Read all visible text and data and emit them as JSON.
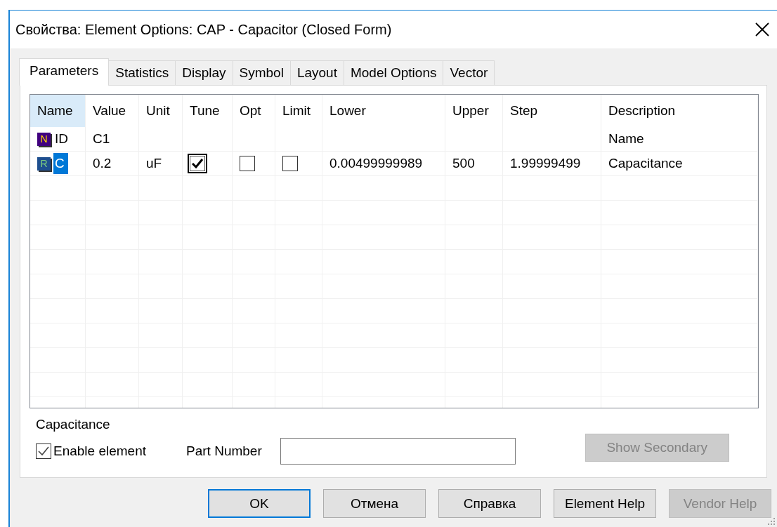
{
  "window": {
    "title": "Свойства: Element Options: CAP - Capacitor (Closed Form)"
  },
  "tabs": [
    {
      "label": "Parameters",
      "selected": true
    },
    {
      "label": "Statistics",
      "selected": false
    },
    {
      "label": "Display",
      "selected": false
    },
    {
      "label": "Symbol",
      "selected": false
    },
    {
      "label": "Layout",
      "selected": false
    },
    {
      "label": "Model Options",
      "selected": false
    },
    {
      "label": "Vector",
      "selected": false
    }
  ],
  "table": {
    "columns": [
      {
        "label": "Name",
        "highlighted": true
      },
      {
        "label": "Value",
        "highlighted": false
      },
      {
        "label": "Unit",
        "highlighted": false
      },
      {
        "label": "Tune",
        "highlighted": false
      },
      {
        "label": "Opt",
        "highlighted": false
      },
      {
        "label": "Limit",
        "highlighted": false
      },
      {
        "label": "Lower",
        "highlighted": false
      },
      {
        "label": "Upper",
        "highlighted": false
      },
      {
        "label": "Step",
        "highlighted": false
      },
      {
        "label": "Description",
        "highlighted": false
      }
    ],
    "rows": [
      {
        "badge": {
          "letter": "N",
          "kind": "name",
          "color": "#40007f"
        },
        "name": "ID",
        "selected": false,
        "value": "C1",
        "description": "Name"
      },
      {
        "badge": {
          "letter": "R",
          "kind": "real",
          "color": "#1e4f8f"
        },
        "name": "C",
        "selected": true,
        "value": "0.2",
        "unit": "uF",
        "tune": {
          "checked": true,
          "focused": true
        },
        "opt": {
          "checked": false,
          "focused": false
        },
        "limit": {
          "checked": false,
          "focused": false
        },
        "lower": "0.00499999989",
        "upper": "500",
        "step": "1.99999499",
        "description": "Capacitance"
      }
    ]
  },
  "description_label": "Capacitance",
  "enable_element": {
    "label": "Enable element",
    "checked": true
  },
  "part_number": {
    "label": "Part Number"
  },
  "show_secondary": {
    "label": "Show Secondary",
    "disabled": true
  },
  "buttons": [
    {
      "label": "OK",
      "default": true,
      "disabled": false
    },
    {
      "label": "Отмена",
      "default": false,
      "disabled": false
    },
    {
      "label": "Справка",
      "default": false,
      "disabled": false
    },
    {
      "label": "Element Help",
      "default": false,
      "disabled": false
    },
    {
      "label": "Vendor Help",
      "default": false,
      "disabled": true
    }
  ]
}
